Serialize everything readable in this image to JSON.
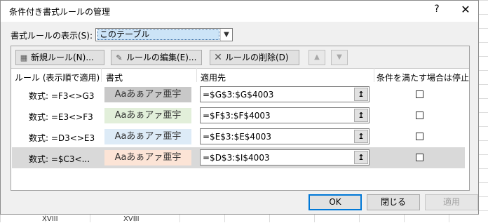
{
  "background": {
    "cells": [
      "XVIII",
      "XVIII"
    ]
  },
  "window": {
    "title": "条件付き書式ルールの管理",
    "help": "?",
    "close": "✕"
  },
  "show_rules": {
    "label": "書式ルールの表示(S):",
    "value": "このテーブル"
  },
  "toolbar": {
    "new_rule": "新規ルール(N)...",
    "edit_rule": "ルールの編集(E)...",
    "delete_rule": "ルールの削除(D)",
    "move_up": "▲",
    "move_down": "▼"
  },
  "columns": {
    "rule": "ルール (表示順で適用)",
    "format": "書式",
    "applies_to": "適用先",
    "stop_if_true": "条件を満たす場合は停止"
  },
  "rules": [
    {
      "rule": "数式: =F3<>G3",
      "preview": "Aaあぁアァ亜宇",
      "fill": "#c8c8c8",
      "applies_to": "=$G$3:$G$4003",
      "stop": false
    },
    {
      "rule": "数式: =E3<>F3",
      "preview": "Aaあぁアァ亜宇",
      "fill": "#e2efda",
      "applies_to": "=$F$3:$F$4003",
      "stop": false
    },
    {
      "rule": "数式: =D3<>E3",
      "preview": "Aaあぁアァ亜宇",
      "fill": "#ddebf7",
      "applies_to": "=$E$3:$E$4003",
      "stop": false
    },
    {
      "rule": "数式: =$C3<...",
      "preview": "Aaあぁアァ亜宇",
      "fill": "#fce4d6",
      "applies_to": "=$D$3:$I$4003",
      "stop": false
    }
  ],
  "footer": {
    "ok": "OK",
    "close": "閉じる",
    "apply": "適用"
  }
}
